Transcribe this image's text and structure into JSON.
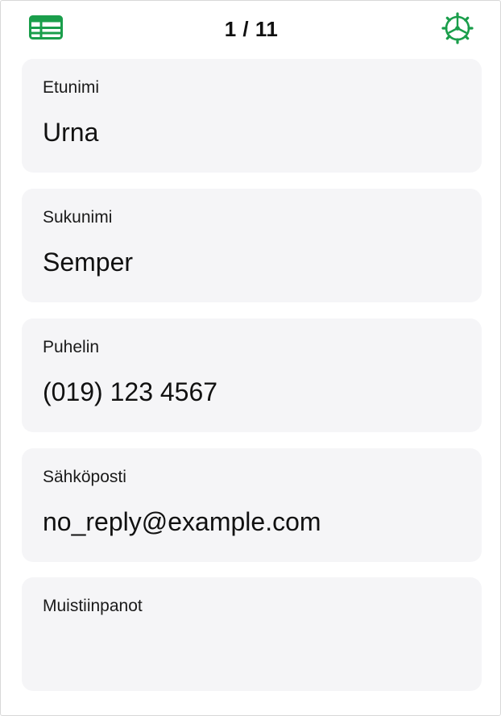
{
  "header": {
    "record_counter": "1 / 11",
    "table_icon": "table-grid-icon",
    "settings_icon": "gear-icon",
    "accent_color": "#1a9e4b"
  },
  "fields": [
    {
      "label": "Etunimi",
      "value": "Urna"
    },
    {
      "label": "Sukunimi",
      "value": "Semper"
    },
    {
      "label": "Puhelin",
      "value": "(019) 123 4567"
    },
    {
      "label": "Sähköposti",
      "value": "no_reply@example.com"
    },
    {
      "label": "Muistiinpanot",
      "value": ""
    }
  ]
}
